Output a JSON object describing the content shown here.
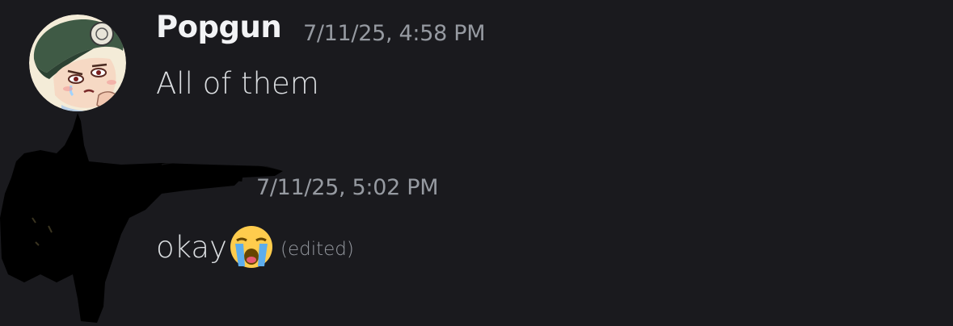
{
  "messages": [
    {
      "author": "Popgun",
      "timestamp": "7/11/25, 4:58 PM",
      "text": "All of them"
    },
    {
      "author": "",
      "timestamp": "7/11/25, 5:02 PM",
      "text": "okay",
      "emoji": "loudly-crying-face-emoji",
      "edited_label": "(edited)"
    }
  ],
  "colors": {
    "background": "#1a1a1e",
    "username": "#f2f3f5",
    "message_text": "#dbdee1",
    "muted": "#969aa1",
    "redaction": "#000000"
  }
}
